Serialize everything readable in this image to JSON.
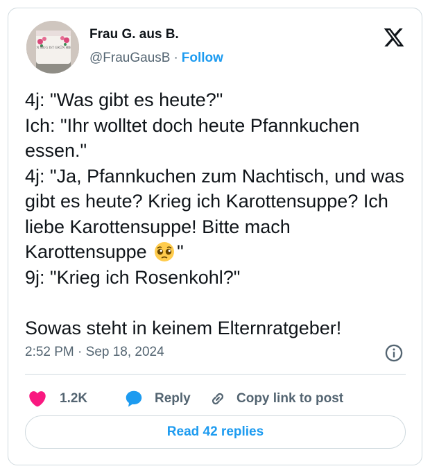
{
  "author": {
    "display_name": "Frau G. aus B.",
    "handle": "@FrauGausB",
    "separator": "·",
    "follow_label": "Follow",
    "avatar_text": "EIN MUG IST GRÜN HIER"
  },
  "tweet": {
    "line_1": "4j: \"Was gibt es heute?\"",
    "line_2": "Ich: \"Ihr wolltet doch heute Pfannkuchen essen.\"",
    "line_3_before_emoji": "4j: \"Ja, Pfannkuchen zum Nachtisch, und was gibt es heute? Krieg ich Karottensuppe? Ich liebe Karottensuppe! Bitte mach Karottensuppe ",
    "emoji": "pleading-face",
    "line_3_after_emoji": "\"",
    "line_4": "9j: \"Krieg ich Rosenkohl?\"",
    "line_5": "Sowas steht in keinem Elternratgeber!",
    "timestamp": "2:52 PM · Sep 18, 2024"
  },
  "actions": {
    "like_count": "1.2K",
    "reply_label": "Reply",
    "copy_label": "Copy link to post"
  },
  "read_replies_label": "Read 42 replies",
  "icons": {
    "logo": "x-logo-icon",
    "info": "info-icon",
    "like": "heart-icon",
    "reply": "speech-bubble-icon",
    "copy": "link-icon"
  },
  "colors": {
    "accent": "#1d9bf0",
    "like": "#f91880",
    "text": "#0f1419",
    "muted": "#536471",
    "border": "#cfd9de"
  }
}
